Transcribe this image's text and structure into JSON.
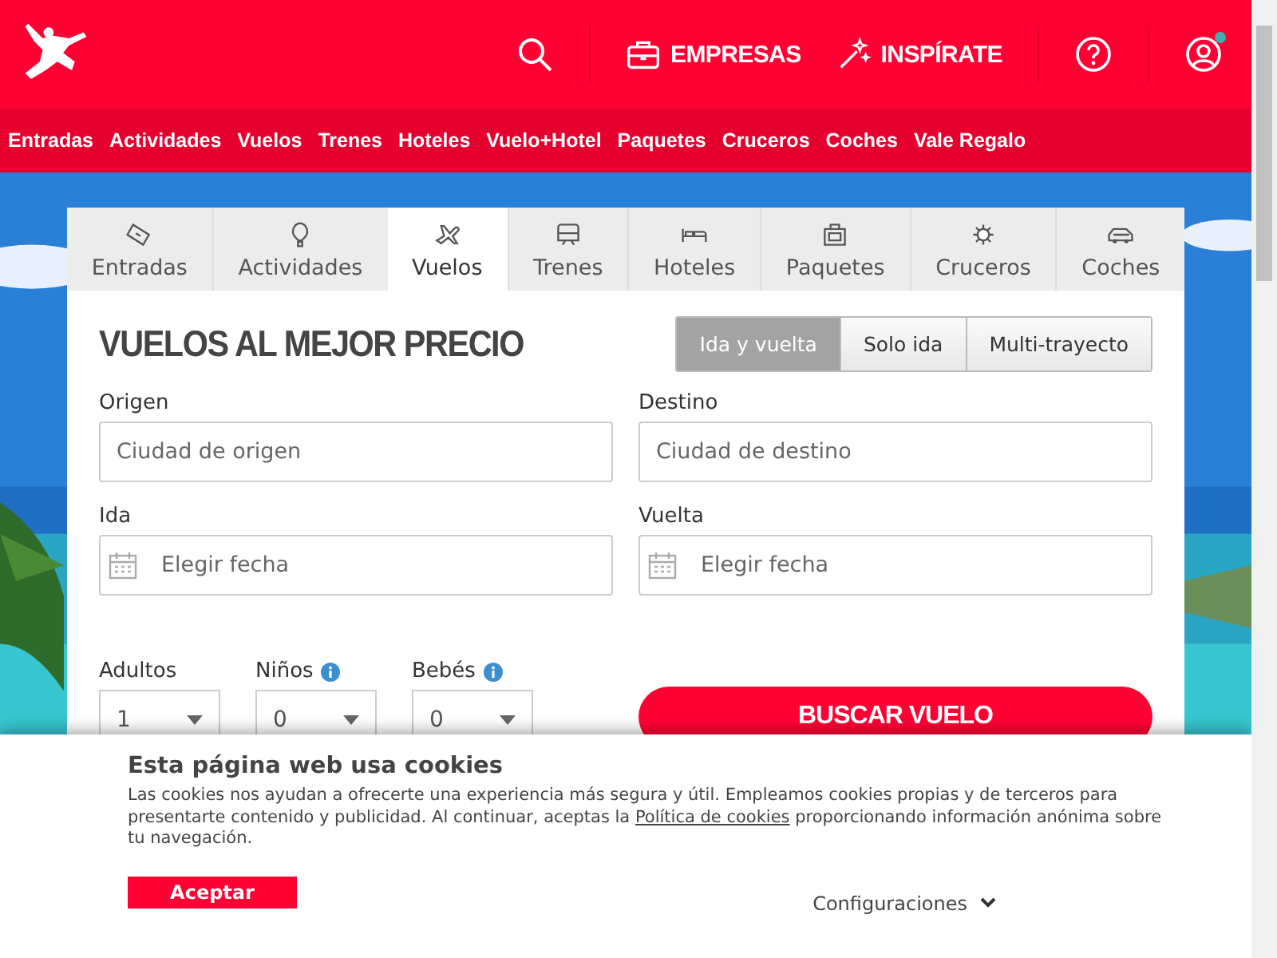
{
  "header": {
    "links": [
      "EMPRESAS",
      "INSPÍRATE"
    ],
    "account": {
      "notification": true
    }
  },
  "nav": [
    "Entradas",
    "Actividades",
    "Vuelos",
    "Trenes",
    "Hoteles",
    "Vuelo+Hotel",
    "Paquetes",
    "Cruceros",
    "Coches",
    "Vale Regalo"
  ],
  "search": {
    "tabs": [
      {
        "label": "Entradas",
        "selected": false
      },
      {
        "label": "Actividades",
        "selected": false
      },
      {
        "label": "Vuelos",
        "selected": true
      },
      {
        "label": "Trenes",
        "selected": false
      },
      {
        "label": "Hoteles",
        "selected": false
      },
      {
        "label": "Paquetes",
        "selected": false
      },
      {
        "label": "Cruceros",
        "selected": false
      },
      {
        "label": "Coches",
        "selected": false
      }
    ],
    "title": "VUELOS AL MEJOR PRECIO",
    "trip_types": [
      {
        "label": "Ida y vuelta",
        "selected": true
      },
      {
        "label": "Solo ida",
        "selected": false
      },
      {
        "label": "Multi-trayecto",
        "selected": false
      }
    ],
    "fields": [
      {
        "label": "Origen",
        "placeholder": "Ciudad de origen",
        "kind": "text"
      },
      {
        "label": "Destino",
        "placeholder": "Ciudad de destino",
        "kind": "text"
      },
      {
        "label": "Ida",
        "placeholder": "Elegir fecha",
        "kind": "date"
      },
      {
        "label": "Vuelta",
        "placeholder": "Elegir fecha",
        "kind": "date"
      }
    ],
    "passengers": [
      {
        "label": "Adultos",
        "value": "1",
        "info": false
      },
      {
        "label": "Niños",
        "value": "0",
        "info": true
      },
      {
        "label": "Bebés",
        "value": "0",
        "info": true
      }
    ],
    "submit": "BUSCAR VUELO"
  },
  "cookies": {
    "title": "Esta página web usa cookies",
    "text_before": "Las cookies nos ayudan a ofrecerte una experiencia más segura y útil. Empleamos cookies propias y de terceros para presentarte contenido y publicidad. Al continuar, aceptas la",
    "link": "Política de cookies",
    "text_after": "proporcionando información anónima sobre tu navegación.",
    "accept": "Aceptar",
    "settings": "Configuraciones"
  }
}
